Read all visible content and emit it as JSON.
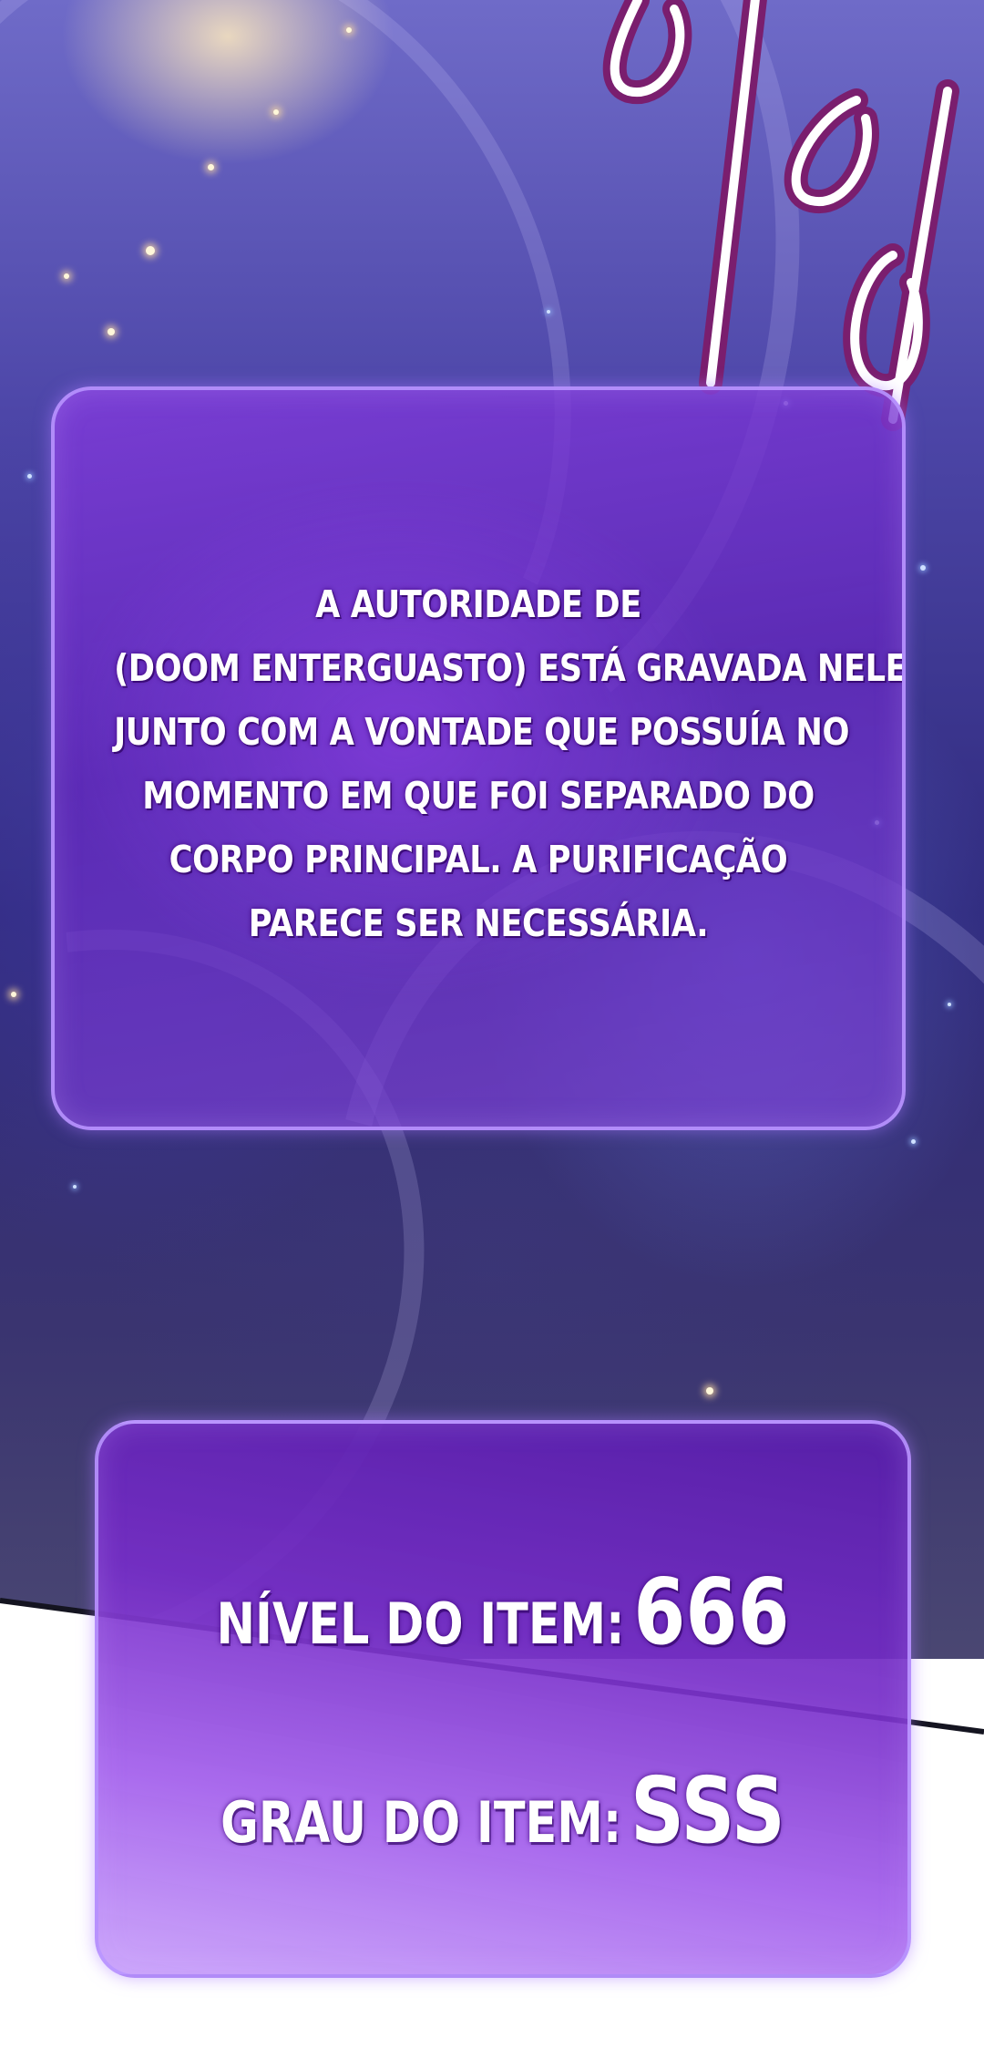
{
  "description": {
    "lines": [
      "A AUTORIDADE DE",
      "(DOOM ENTERGUASTO) ESTÁ GRAVADA NELE,",
      "JUNTO COM A VONTADE QUE POSSUÍA NO",
      "MOMENTO EM QUE FOI SEPARADO DO",
      "CORPO PRINCIPAL. A PURIFICAÇÃO",
      "PARECE SER NECESSÁRIA."
    ]
  },
  "stats": {
    "level_label": "NÍVEL DO ITEM:",
    "level_value": "666",
    "grade_label": "GRAU DO ITEM:",
    "grade_value": "SSS"
  },
  "decoration": {
    "symbol": "%",
    "panel_border_color": "#b996ff",
    "panel_fill_color": "#7a32d2"
  }
}
